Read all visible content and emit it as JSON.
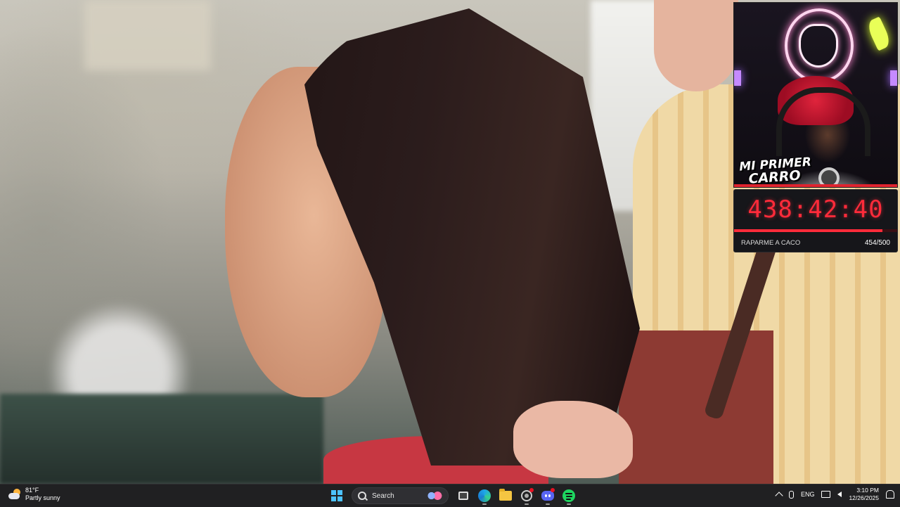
{
  "overlay": {
    "banner_line1": "MI PRIMER",
    "banner_line2": "CARRO",
    "timer": "438:42:40",
    "goal_label": "RAPARME A CACO",
    "goal_count": "454/500",
    "goal_progress": 0.908,
    "accent_color": "#ff2b3a"
  },
  "taskbar": {
    "weather_temp": "81°F",
    "weather_desc": "Partly sunny",
    "search_placeholder": "Search",
    "language": "ENG",
    "time": "3:10 PM",
    "date": "12/26/2025",
    "pinned_icons": [
      "windows-start-icon",
      "search-icon",
      "task-view-icon",
      "edge-icon",
      "file-explorer-icon",
      "chrome-icon",
      "discord-icon",
      "spotify-icon"
    ],
    "tray_icons": [
      "chevron-up-icon",
      "microphone-icon",
      "monitor-icon",
      "speaker-icon",
      "notification-bell-icon"
    ]
  }
}
